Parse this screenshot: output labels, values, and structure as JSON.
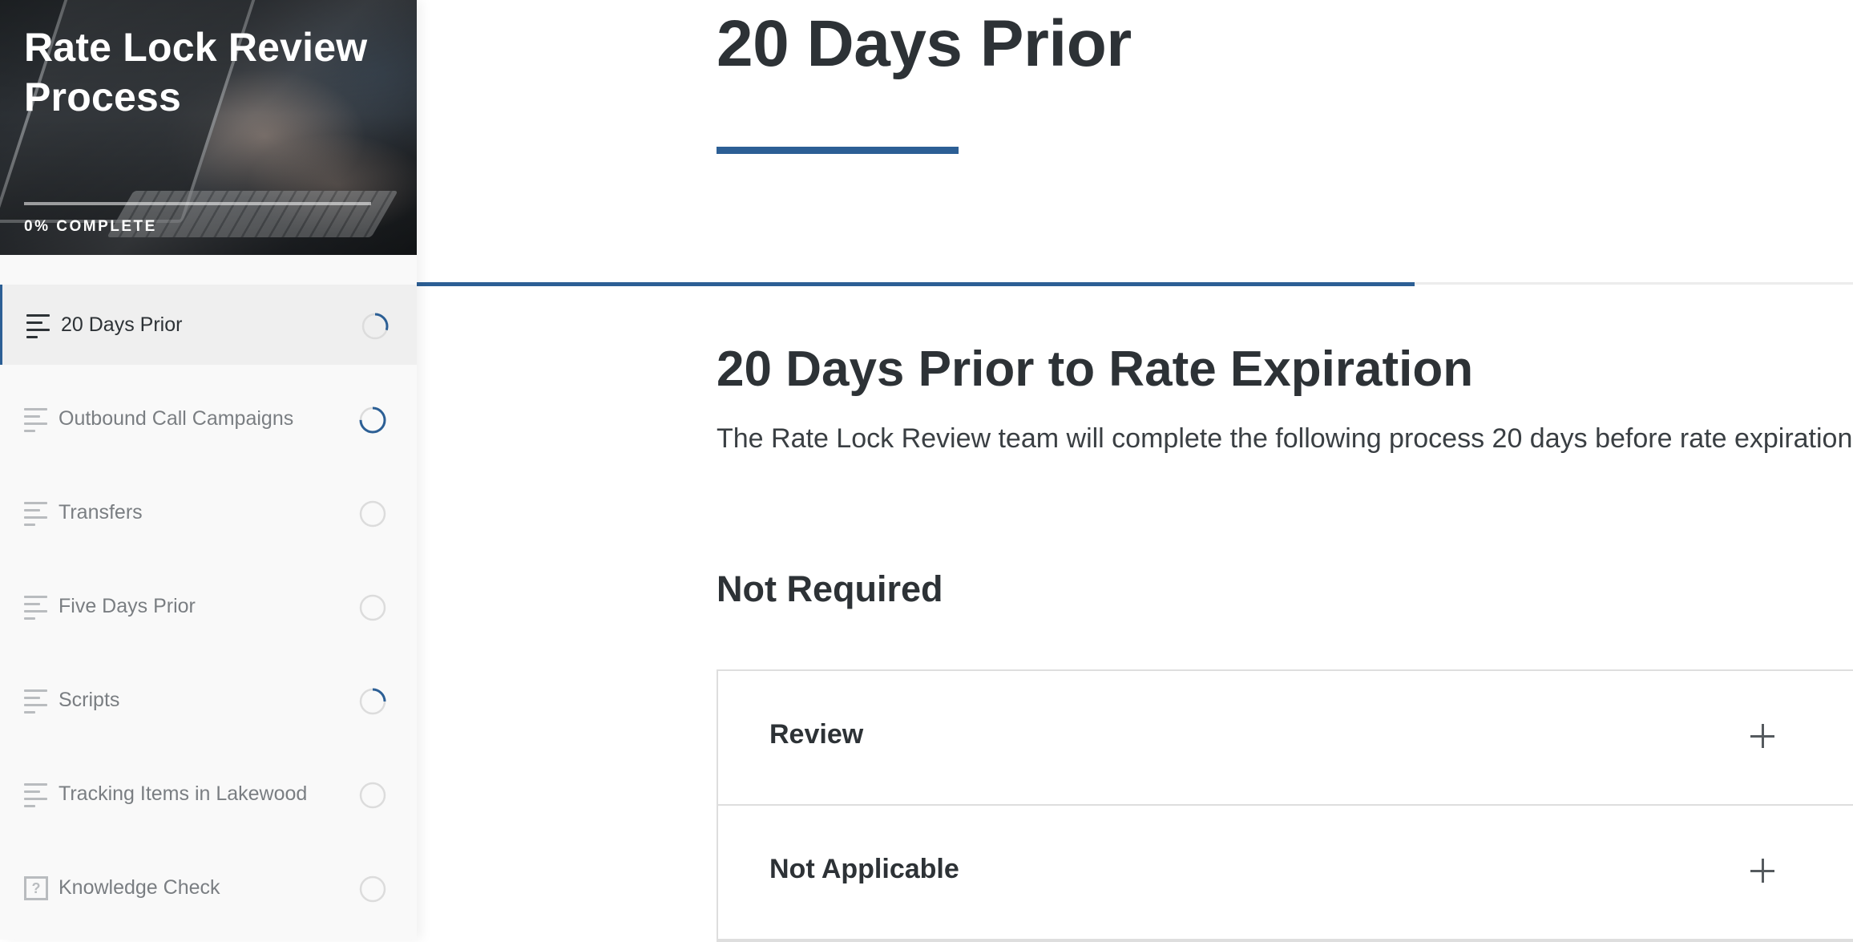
{
  "sidebar": {
    "course_title": "Rate Lock Review Process",
    "progress_label": "0% COMPLETE",
    "progress_fraction": 0,
    "items": [
      {
        "label": "20 Days Prior",
        "icon": "lines-icon",
        "active": true,
        "progress": 0.3
      },
      {
        "label": "Outbound Call Campaigns",
        "icon": "lines-icon",
        "active": false,
        "progress": 0.75
      },
      {
        "label": "Transfers",
        "icon": "lines-icon",
        "active": false,
        "progress": 0
      },
      {
        "label": "Five Days Prior",
        "icon": "lines-icon",
        "active": false,
        "progress": 0
      },
      {
        "label": "Scripts",
        "icon": "lines-icon",
        "active": false,
        "progress": 0.25
      },
      {
        "label": "Tracking Items in Lakewood",
        "icon": "lines-icon",
        "active": false,
        "progress": 0
      },
      {
        "label": "Knowledge Check",
        "icon": "quiz-icon",
        "active": false,
        "progress": 0
      }
    ]
  },
  "main": {
    "lesson_title": "20 Days Prior",
    "lesson_progress": 0.695,
    "section_heading": "20 Days Prior to Rate Expiration",
    "section_body": "The Rate Lock Review team will complete the following process 20 days before rate expiration:",
    "subheading": "Not Required",
    "accordion": [
      {
        "title": "Review"
      },
      {
        "title": "Not Applicable"
      }
    ]
  },
  "colors": {
    "accent": "#2c5f95",
    "text": "#2d3236",
    "muted": "#7a7e82",
    "ring_track": "#dcdcdc"
  }
}
